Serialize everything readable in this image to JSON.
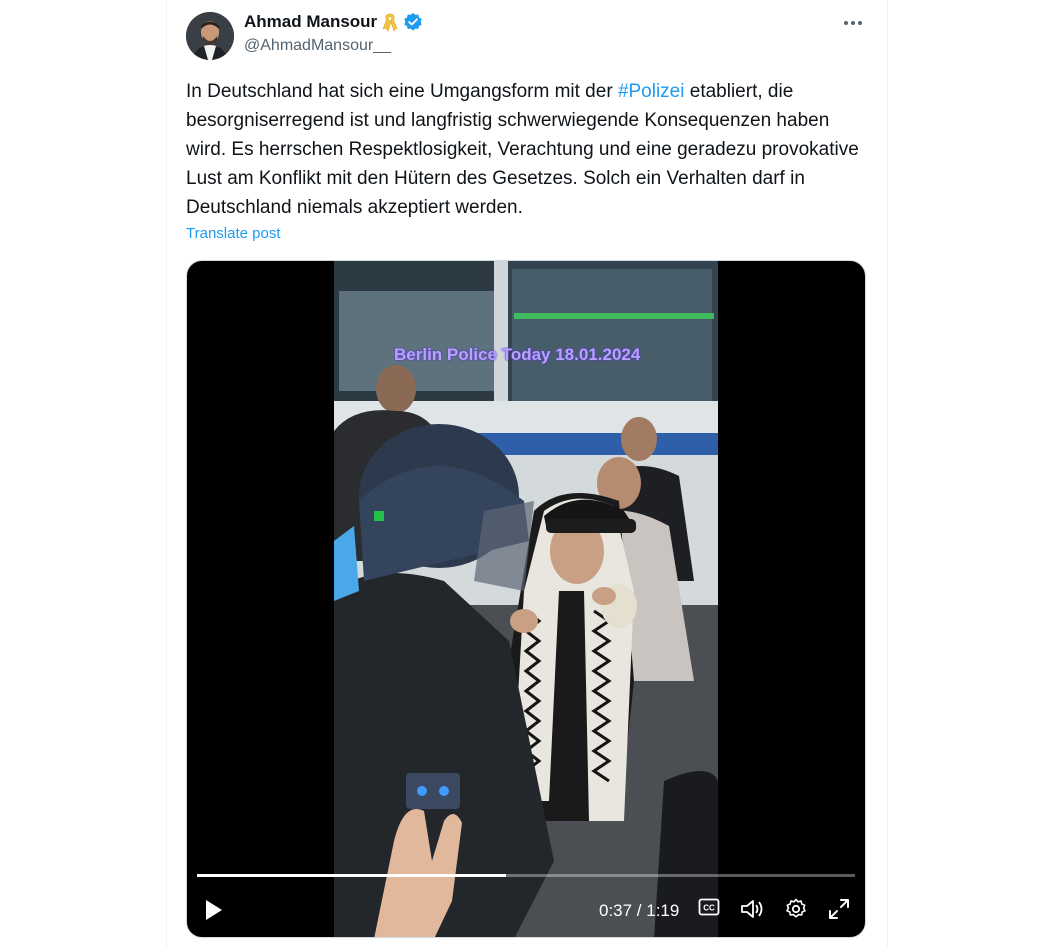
{
  "author": {
    "name": "Ahmad Mansour",
    "handle": "@AhmadMansour__",
    "icons": [
      "yellow-ribbon-icon",
      "verified-badge-icon"
    ]
  },
  "post": {
    "text_before_hashtag": "In Deutschland hat sich eine Umgangsform mit der ",
    "hashtag": "#Polizei",
    "text_after_hashtag": " etabliert, die besorgniserregend ist und langfristig schwerwiegende Konsequenzen haben wird. Es herrschen Respektlosigkeit, Verachtung und eine geradezu provokative Lust am Konflikt mit den Hütern des Gesetzes. Solch ein Verhalten darf in Deutschland niemals akzeptiert werden.",
    "translate_label": "Translate post"
  },
  "video": {
    "overlay_caption": "Berlin Police Today 18.01.2024",
    "time_display": "0:37 / 1:19",
    "progress_fraction": 0.47
  },
  "colors": {
    "accent": "#1d9bf0",
    "verified": "#1d9bf0",
    "ribbon": "#f5c542"
  }
}
